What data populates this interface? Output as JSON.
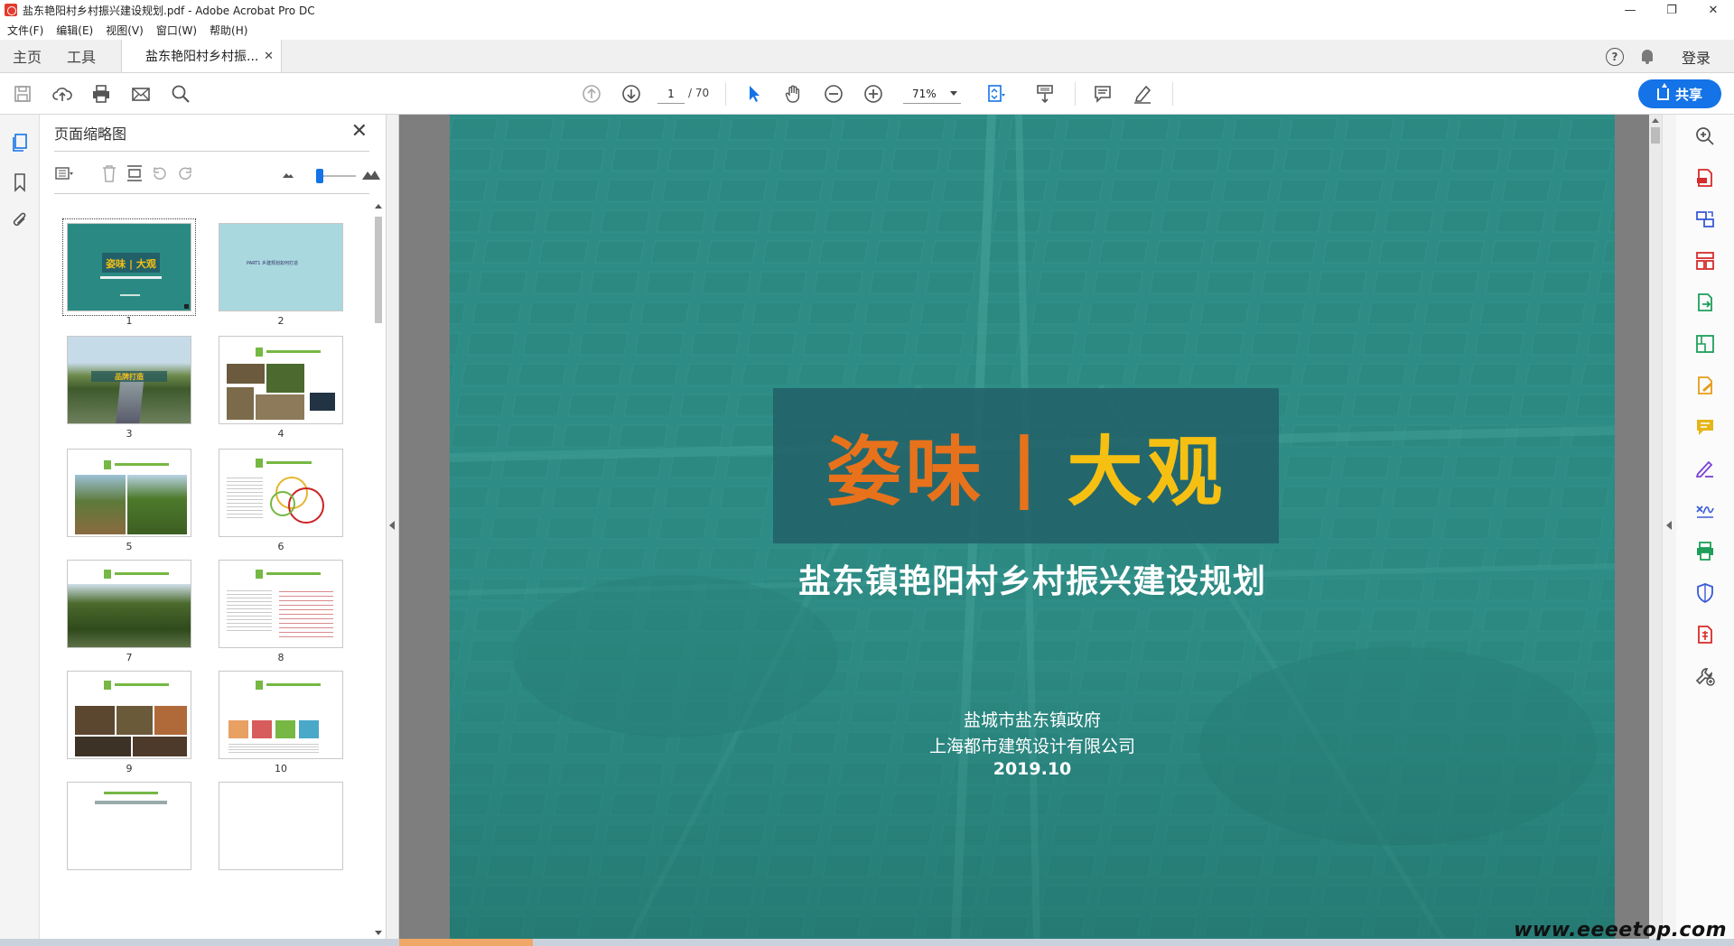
{
  "window": {
    "title": "盐东艳阳村乡村振兴建设规划.pdf - Adobe Acrobat Pro DC",
    "minimize": "—",
    "restore": "❐",
    "close": "✕"
  },
  "menu": [
    "文件(F)",
    "编辑(E)",
    "视图(V)",
    "窗口(W)",
    "帮助(H)"
  ],
  "tabs": {
    "home": "主页",
    "tools": "工具",
    "document": "盐东艳阳村乡村振...",
    "close": "✕"
  },
  "account": {
    "help": "?",
    "login": "登录"
  },
  "toolbar": {
    "current_page": "1",
    "total_pages": "/ 70",
    "zoom": "71%",
    "share": "共享"
  },
  "thumbnail_panel": {
    "title": "页面缩略图",
    "close": "✕",
    "page_labels": [
      "1",
      "2",
      "3",
      "4",
      "5",
      "6",
      "7",
      "8",
      "9",
      "10"
    ],
    "thumb_texts": {
      "p1_title": "姿味 | 大观",
      "p2_text": "PART1  乡建规划如何打造",
      "p3_text": "品牌打造"
    }
  },
  "page": {
    "title_part1": "姿味",
    "title_sep": "|",
    "title_part2": "大观",
    "subtitle": "盐东镇艳阳村乡村振兴建设规划",
    "org1": "盐城市盐东镇政府",
    "org2": "上海都市建筑设计有限公司",
    "date": "2019.10"
  },
  "colors": {
    "accent_blue": "#1473e6",
    "page_teal": "#2d8c85",
    "title_orange": "#e8721b",
    "title_yellow": "#f6c012"
  },
  "watermark": "www.eeeetop.com"
}
